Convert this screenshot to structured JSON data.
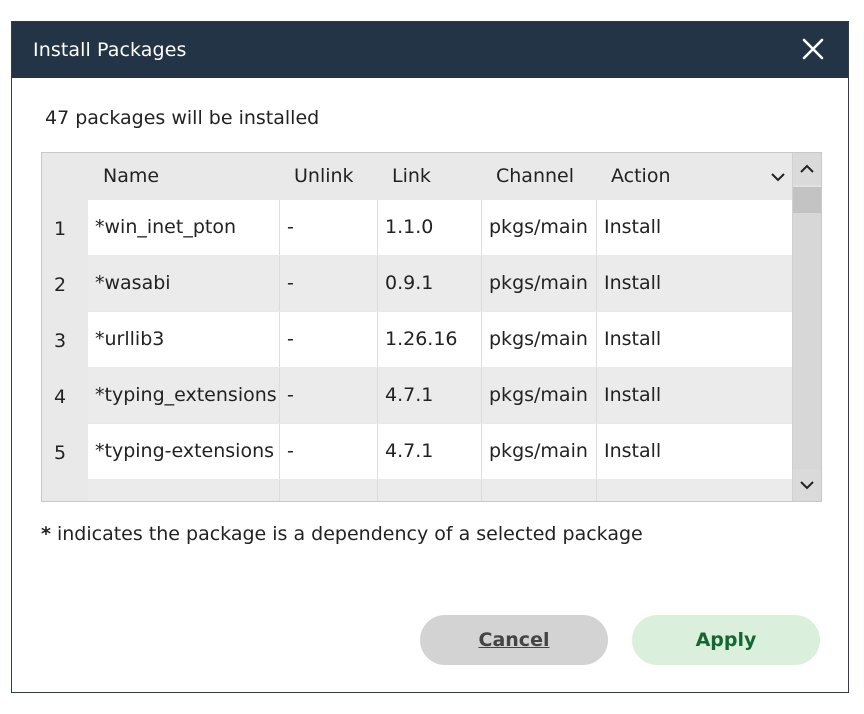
{
  "dialog": {
    "title": "Install Packages",
    "close_icon": "close-icon",
    "summary": "47 packages will be installed",
    "footnote_marker": "*",
    "footnote_text": " indicates the package is a dependency of a selected package",
    "cancel_label": "Cancel",
    "apply_label": "Apply"
  },
  "table": {
    "columns": [
      "Name",
      "Unlink",
      "Link",
      "Channel",
      "Action"
    ],
    "sort_icon": "chevron-down-icon",
    "rows": [
      {
        "num": "1",
        "name": "*win_inet_pton",
        "unlink": "-",
        "link": "1.1.0",
        "channel": "pkgs/main",
        "action": "Install"
      },
      {
        "num": "2",
        "name": "*wasabi",
        "unlink": "-",
        "link": "0.9.1",
        "channel": "pkgs/main",
        "action": "Install"
      },
      {
        "num": "3",
        "name": "*urllib3",
        "unlink": "-",
        "link": "1.26.16",
        "channel": "pkgs/main",
        "action": "Install"
      },
      {
        "num": "4",
        "name": "*typing_extensions",
        "unlink": "-",
        "link": "4.7.1",
        "channel": "pkgs/main",
        "action": "Install"
      },
      {
        "num": "5",
        "name": "*typing-extensions",
        "unlink": "-",
        "link": "4.7.1",
        "channel": "pkgs/main",
        "action": "Install"
      }
    ]
  },
  "colors": {
    "titlebar": "#243447",
    "apply_bg": "#daf0dd",
    "apply_text": "#166534",
    "cancel_bg": "#d3d3d3"
  }
}
